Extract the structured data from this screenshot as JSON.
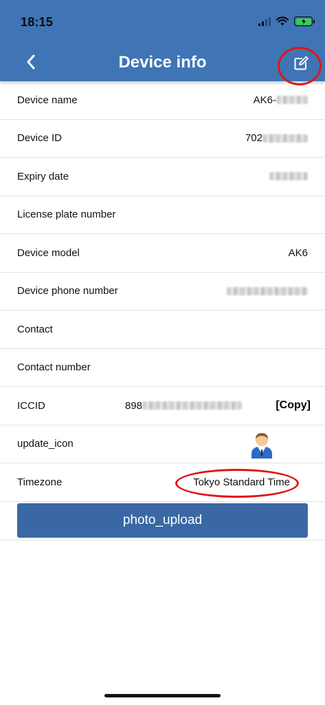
{
  "status_bar": {
    "time": "18:15"
  },
  "nav": {
    "title": "Device info"
  },
  "rows": [
    {
      "label": "Device name",
      "value": "AK6-"
    },
    {
      "label": "Device ID",
      "value": "702"
    },
    {
      "label": "Expiry date",
      "value": ""
    },
    {
      "label": "License plate number",
      "value": ""
    },
    {
      "label": "Device model",
      "value": "AK6"
    },
    {
      "label": "Device phone number",
      "value": ""
    },
    {
      "label": "Contact",
      "value": ""
    },
    {
      "label": "Contact number",
      "value": ""
    }
  ],
  "iccid": {
    "label": "ICCID",
    "value": "898",
    "copy_label": "[Copy]"
  },
  "update_icon": {
    "label": "update_icon"
  },
  "timezone": {
    "label": "Timezone",
    "value": "Tokyo Standard Time"
  },
  "upload": {
    "label": "photo_upload"
  },
  "colors": {
    "header": "#3f75b5",
    "button": "#3a68a4",
    "annotation": "#e01515",
    "battery": "#38d04a"
  },
  "icons": [
    "back-chevron-icon",
    "edit-icon",
    "signal-icon",
    "wifi-icon",
    "battery-icon",
    "avatar-icon"
  ]
}
